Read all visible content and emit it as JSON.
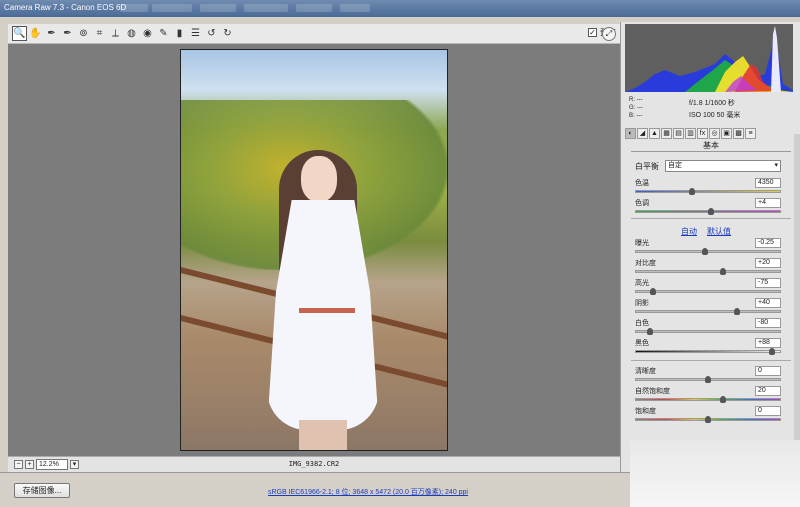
{
  "window": {
    "title": "Camera Raw 7.3 - Canon EOS 6D"
  },
  "toolbar": {
    "tools": [
      {
        "name": "zoom-icon",
        "glyph": "🔍"
      },
      {
        "name": "hand-icon",
        "glyph": "✋"
      },
      {
        "name": "white-balance-icon",
        "glyph": "✒"
      },
      {
        "name": "color-sampler-icon",
        "glyph": "✒"
      },
      {
        "name": "target-adjust-icon",
        "glyph": "⊚"
      },
      {
        "name": "crop-icon",
        "glyph": "⌗"
      },
      {
        "name": "straighten-icon",
        "glyph": "⟂"
      },
      {
        "name": "spot-removal-icon",
        "glyph": "◍"
      },
      {
        "name": "red-eye-icon",
        "glyph": "◉"
      },
      {
        "name": "adjustment-brush-icon",
        "glyph": "✎"
      },
      {
        "name": "graduated-filter-icon",
        "glyph": "▮"
      },
      {
        "name": "preferences-icon",
        "glyph": "☰"
      },
      {
        "name": "rotate-left-icon",
        "glyph": "↺"
      },
      {
        "name": "rotate-right-icon",
        "glyph": "↻"
      }
    ],
    "preview_checked": "✓",
    "preview_label": "预览"
  },
  "canvas": {
    "zoom_value": "12.2%",
    "filename": "IMG_9382.CR2"
  },
  "bottom": {
    "save_label": "存储图像...",
    "workflow_link": "sRGB IEC61966-2.1; 8 位; 3648 x 5472 (20.0 百万像素); 240 ppi"
  },
  "histogram_info": {
    "r": "R:  ---",
    "g": "G:  ---",
    "b": "B:  ---",
    "line1": "f/1.8   1/1600 秒",
    "line2": "ISO 100   50 毫米"
  },
  "panel": {
    "section_title": "基本",
    "wb_label": "白平衡",
    "wb_value": "自定",
    "auto_label": "自动",
    "default_label": "默认值",
    "temp": {
      "label": "色温",
      "value": "4350"
    },
    "tint": {
      "label": "色调",
      "value": "+4"
    },
    "exposure": {
      "label": "曝光",
      "value": "-0.25"
    },
    "contrast": {
      "label": "对比度",
      "value": "+20"
    },
    "highlights": {
      "label": "高光",
      "value": "-75"
    },
    "shadows": {
      "label": "阴影",
      "value": "+40"
    },
    "whites": {
      "label": "白色",
      "value": "-80"
    },
    "blacks": {
      "label": "黑色",
      "value": "+88"
    },
    "clarity": {
      "label": "清晰度",
      "value": "0"
    },
    "vibrance": {
      "label": "自然饱和度",
      "value": "20"
    },
    "saturation": {
      "label": "饱和度",
      "value": "0"
    }
  }
}
